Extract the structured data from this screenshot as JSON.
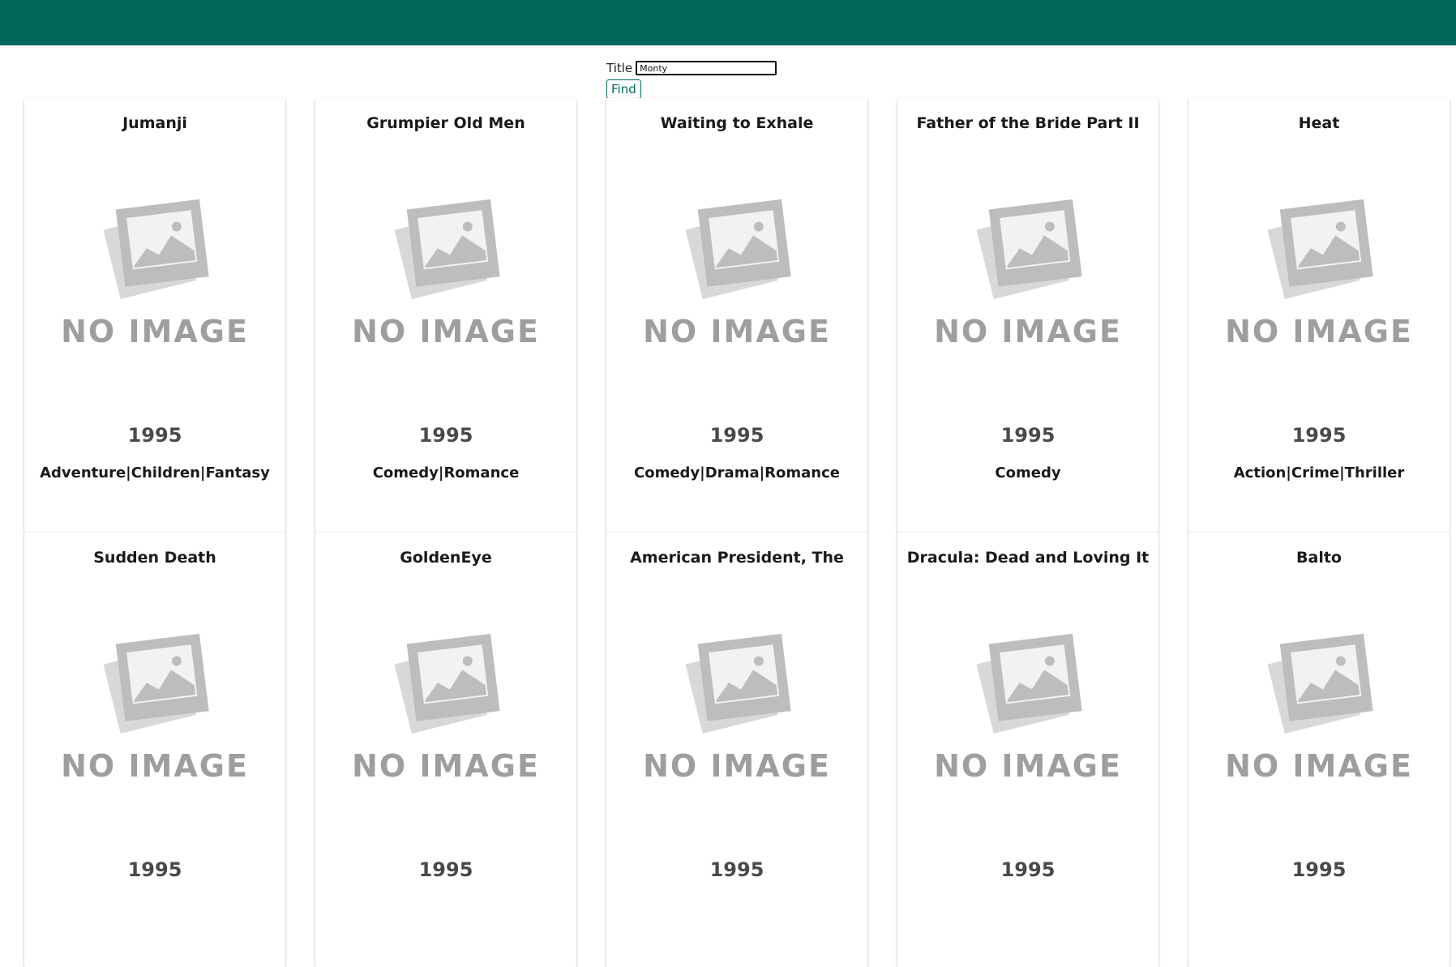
{
  "search": {
    "label": "Title",
    "value": "Monty",
    "button_label": "Find"
  },
  "colors": {
    "header": "#00695c",
    "accent": "#00695c"
  },
  "placeholder_image": {
    "icon": "no-image-placeholder",
    "text": "NO IMAGE"
  },
  "movies": [
    {
      "title": "Jumanji",
      "year": "1995",
      "genres": "Adventure|Children|Fantasy"
    },
    {
      "title": "Grumpier Old Men",
      "year": "1995",
      "genres": "Comedy|Romance"
    },
    {
      "title": "Waiting to Exhale",
      "year": "1995",
      "genres": "Comedy|Drama|Romance"
    },
    {
      "title": "Father of the Bride Part II",
      "year": "1995",
      "genres": "Comedy"
    },
    {
      "title": "Heat",
      "year": "1995",
      "genres": "Action|Crime|Thriller"
    },
    {
      "title": "Sudden Death",
      "year": "1995",
      "genres": ""
    },
    {
      "title": "GoldenEye",
      "year": "1995",
      "genres": ""
    },
    {
      "title": "American President, The",
      "year": "1995",
      "genres": ""
    },
    {
      "title": "Dracula: Dead and Loving It",
      "year": "1995",
      "genres": ""
    },
    {
      "title": "Balto",
      "year": "1995",
      "genres": ""
    }
  ]
}
